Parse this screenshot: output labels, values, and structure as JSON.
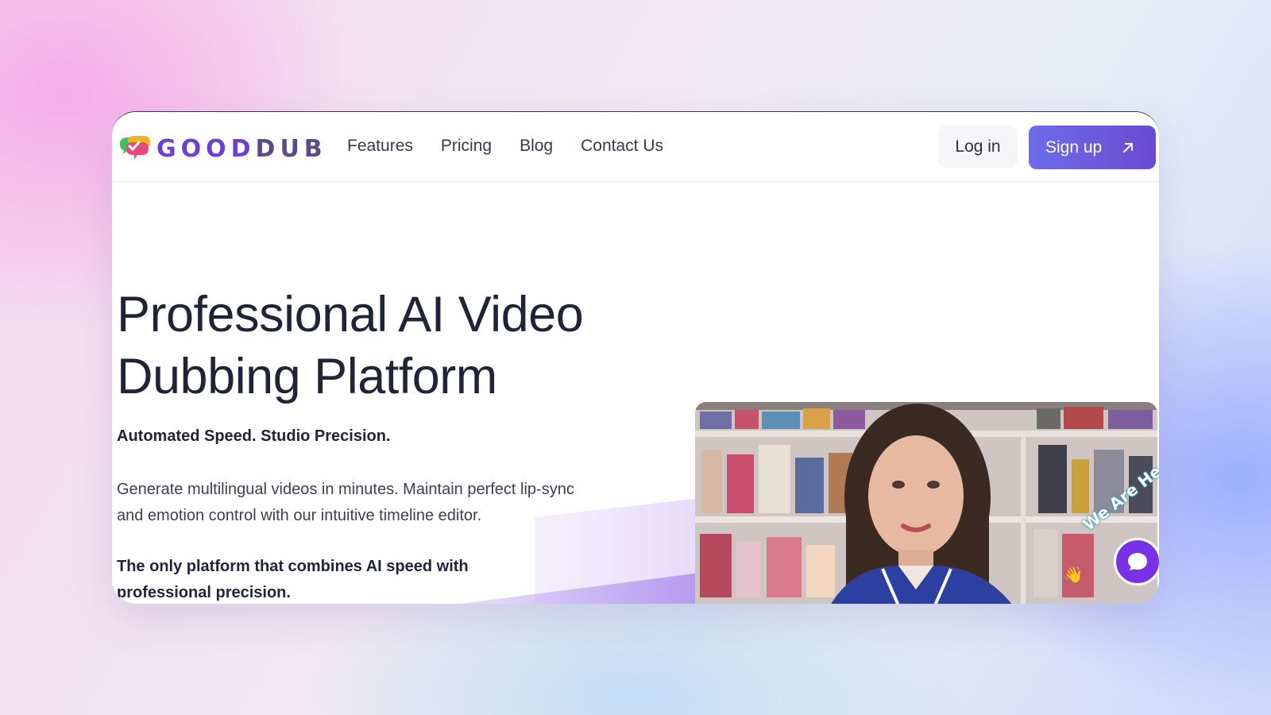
{
  "brand": {
    "name_part1": "GOOD",
    "name_part2": "DUB",
    "logo_icon": "speech-bubbles-check-icon",
    "accent_color": "#6b3fd6"
  },
  "nav": {
    "links": [
      {
        "label": "Features"
      },
      {
        "label": "Pricing"
      },
      {
        "label": "Blog"
      },
      {
        "label": "Contact Us"
      }
    ],
    "login_label": "Log in",
    "signup_label": "Sign up",
    "signup_icon": "arrow-up-right-icon",
    "signup_color": "#6a5ae0"
  },
  "hero": {
    "title_line1": "Professional AI Video",
    "title_line2": "Dubbing Platform",
    "tagline": "Automated Speed. Studio Precision.",
    "description": "Generate multilingual videos in minutes. Maintain perfect lip-sync and emotion control with our intuitive timeline editor.",
    "claim": "The only platform that combines AI speed with professional precision."
  },
  "video": {
    "badge_text": "We Are He",
    "chat_icon": "chat-bubble-icon",
    "wave_icon": "waving-hand-icon",
    "chat_color": "#7a32e6"
  }
}
